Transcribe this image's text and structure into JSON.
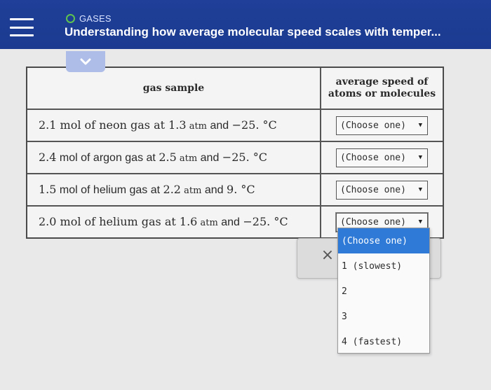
{
  "header": {
    "topic": "GASES",
    "title": "Understanding how average molecular speed scales with temper..."
  },
  "colors": {
    "header_bg": "#1f3f98",
    "topic_dot": "#5ec44f",
    "selected_option": "#2f7ad6"
  },
  "icons": {
    "menu": "hamburger-icon",
    "collapse": "chevron-down-icon",
    "close": "close-icon"
  },
  "table": {
    "headers": {
      "sample": "gas sample",
      "speed_line1": "average speed of",
      "speed_line2": "atoms or molecules"
    },
    "rows": [
      {
        "a": "2.1",
        "b": " mol of neon gas at ",
        "c": "1.3",
        "d": " atm",
        "e": " and ",
        "f": "−25. °C",
        "choice": "(Choose one)"
      },
      {
        "a": "2.4",
        "b": " mol of argon gas at ",
        "c": "2.5",
        "d": " atm",
        "e": " and ",
        "f": "−25. °C",
        "choice": "(Choose one)"
      },
      {
        "a": "1.5",
        "b": " mol of helium gas at ",
        "c": "2.2",
        "d": " atm",
        "e": " and ",
        "f": "9. °C",
        "choice": "(Choose one)"
      },
      {
        "a": "2.0",
        "b": " mol of helium gas at ",
        "c": "1.6",
        "d": " atm",
        "e": " and ",
        "f": "−25. °C",
        "choice": "(Choose one)"
      }
    ]
  },
  "dropdown": {
    "options": [
      "(Choose one)",
      "1 (slowest)",
      "2",
      "3",
      "4 (fastest)"
    ],
    "selected_index": 0
  },
  "popup": {
    "close_symbol": "×"
  }
}
